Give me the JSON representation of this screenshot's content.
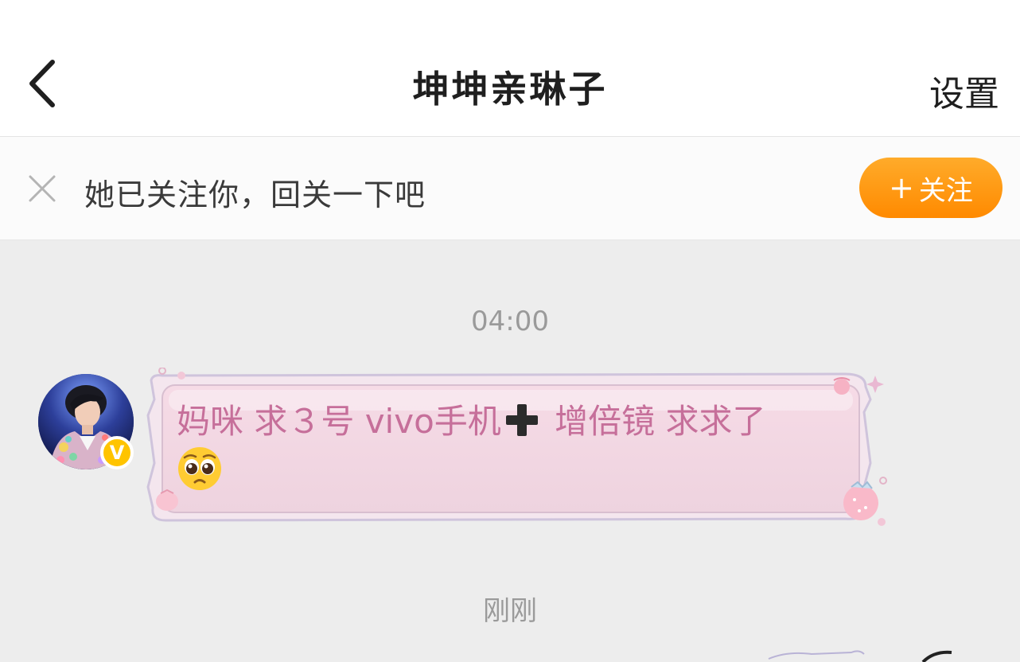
{
  "header": {
    "back_icon": "chevron-left-icon",
    "title": "坤坤亲琳子",
    "settings_label": "设置"
  },
  "follow_banner": {
    "close_icon": "close-icon",
    "text": "她已关注你，回关一下吧",
    "follow_plus": "+",
    "follow_label": "关注",
    "accent_color": "#ff9500"
  },
  "chat": {
    "messages": [
      {
        "timestamp": "04:00",
        "sender_verified_badge": "V",
        "text_part1": "妈咪 求３号 vivo手机",
        "text_part2": " 增倍镜 求求了",
        "emoji_icon": "pleading-face-icon",
        "text_color": "#c66f9a"
      }
    ],
    "second_timestamp": "刚刚"
  }
}
